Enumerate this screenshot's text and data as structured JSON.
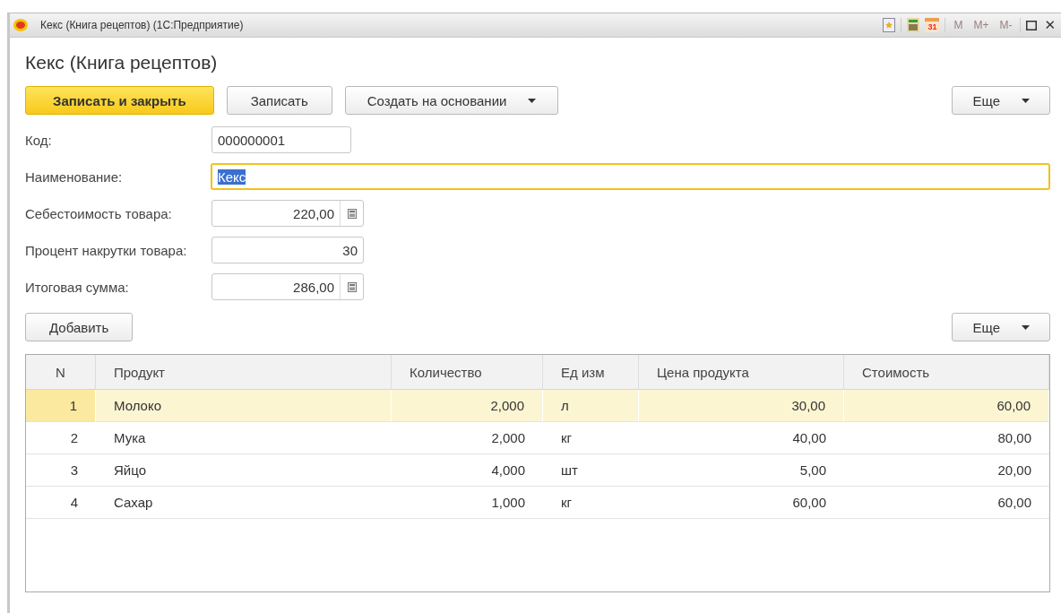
{
  "window": {
    "title": "Кекс (Книга рецептов)  (1С:Предприятие)",
    "calendar_day": "31",
    "memory_buttons": [
      {
        "label": "M",
        "disabled": true
      },
      {
        "label": "M+",
        "disabled": true
      },
      {
        "label": "M-",
        "disabled": true
      }
    ],
    "close": "✕"
  },
  "form_title": "Кекс (Книга рецептов)",
  "toolbar": {
    "buttons": [
      {
        "label": "Записать и закрыть",
        "kind": "primary"
      },
      {
        "label": "Записать",
        "kind": "plain"
      },
      {
        "label": "Создать на основании",
        "kind": "dropdown"
      }
    ],
    "more": "Еще"
  },
  "fields": [
    {
      "label": "Код:",
      "value": "000000001",
      "kind": "code",
      "focused": false
    },
    {
      "label": "Наименование:",
      "value": "Кекс",
      "kind": "wide",
      "focused": true
    },
    {
      "label": "Себестоимость товара:",
      "value": "220,00",
      "kind": "calc",
      "focused": false
    },
    {
      "label": "Процент накрутки товара:",
      "value": "30",
      "kind": "number",
      "focused": false
    },
    {
      "label": "Итоговая сумма:",
      "value": "286,00",
      "kind": "calc",
      "focused": false
    }
  ],
  "table_toolbar": {
    "add": "Добавить",
    "more": "Еще"
  },
  "table": {
    "columns": [
      "N",
      "Продукт",
      "Количество",
      "Ед изм",
      "Цена продукта",
      "Стоимость"
    ],
    "rows": [
      {
        "cells": [
          "1",
          "Молоко",
          "2,000",
          "л",
          "30,00",
          "60,00"
        ],
        "selected": true
      },
      {
        "cells": [
          "2",
          "Мука",
          "2,000",
          "кг",
          "40,00",
          "80,00"
        ],
        "selected": false
      },
      {
        "cells": [
          "3",
          "Яйцо",
          "4,000",
          "шт",
          "5,00",
          "20,00"
        ],
        "selected": false
      },
      {
        "cells": [
          "4",
          "Сахар",
          "1,000",
          "кг",
          "60,00",
          "60,00"
        ],
        "selected": false
      }
    ]
  }
}
